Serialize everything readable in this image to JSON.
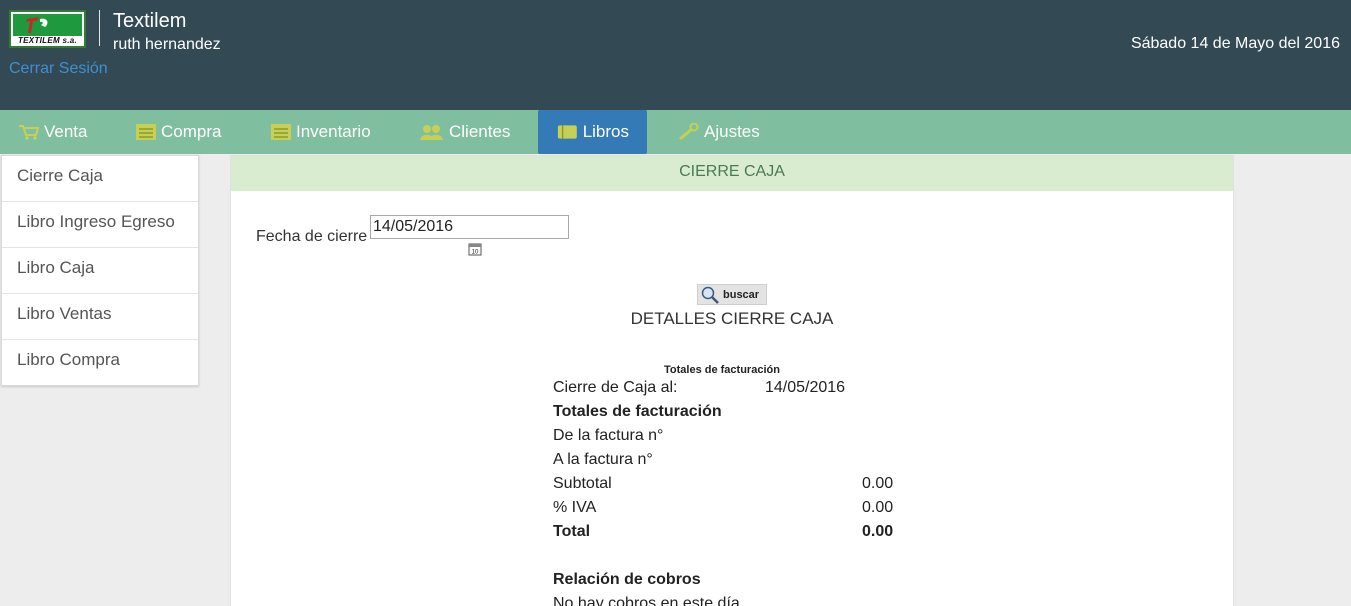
{
  "header": {
    "logo_text": "TEXTILEM s.a.",
    "app_title": "Textilem",
    "user_name": "ruth hernandez",
    "logout": "Cerrar Sesión",
    "date": "Sábado 14 de Mayo del 2016"
  },
  "nav": {
    "items": [
      {
        "label": "Venta",
        "icon": "cart-icon"
      },
      {
        "label": "Compra",
        "icon": "list-icon"
      },
      {
        "label": "Inventario",
        "icon": "list-icon"
      },
      {
        "label": "Clientes",
        "icon": "users-icon"
      },
      {
        "label": "Libros",
        "icon": "books-icon",
        "active": true
      },
      {
        "label": "Ajustes",
        "icon": "wrench-icon"
      }
    ],
    "active_color": "#337ab7",
    "bar_color": "#7fbe9f"
  },
  "sidebar": {
    "items": [
      {
        "label": "Cierre Caja"
      },
      {
        "label": "Libro Ingreso Egreso"
      },
      {
        "label": "Libro Caja"
      },
      {
        "label": "Libro Ventas"
      },
      {
        "label": "Libro Compra"
      }
    ]
  },
  "panel": {
    "title": "CIERRE CAJA",
    "fecha_label": "Fecha de cierre",
    "fecha_value": "14/05/2016",
    "buscar_label": "buscar",
    "details_title": "DETALLES CIERRE CAJA",
    "small_caption": "Totales de facturación",
    "cierre_label": "Cierre de Caja al:",
    "cierre_value": "14/05/2016",
    "totales_heading": "Totales de facturación",
    "de_factura": "De la factura n°",
    "a_factura": "A la factura n°",
    "subtotal_label": "Subtotal",
    "subtotal_value": "0.00",
    "iva_label": "% IVA",
    "iva_value": "0.00",
    "total_label": "Total",
    "total_value": "0.00",
    "cobros_heading": "Relación de cobros",
    "no_cobros": "No hay cobros en este día"
  }
}
